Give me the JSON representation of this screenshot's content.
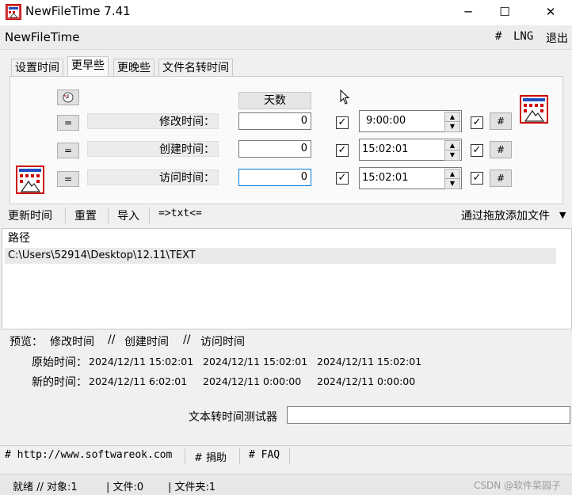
{
  "window": {
    "title": "NewFileTime 7.41",
    "minimize_glyph": "─",
    "maximize_glyph": "☐",
    "close_glyph": "✕"
  },
  "menubar": {
    "app_label": "NewFileTime",
    "items": [
      "#",
      "LNG",
      "退出"
    ]
  },
  "tabs": [
    "设置时间",
    "更早些",
    "更晚些",
    "文件名转时间"
  ],
  "active_tab": "更早些",
  "panel": {
    "days_header": "天数",
    "equals_label": "=",
    "hash_label": "#",
    "check_mark": "✓",
    "rows": [
      {
        "label": "修改时间：",
        "days": "0",
        "time": "9:00:00"
      },
      {
        "label": "创建时间：",
        "days": "0",
        "time": "15:02:01"
      },
      {
        "label": "访问时间：",
        "days": "0",
        "time": "15:02:01"
      }
    ]
  },
  "toolbar": {
    "update_label": "更新时间",
    "reset_label": "重置",
    "import_label": "导入",
    "txt_label": "=>txt<=",
    "drag_label": "通过拖放添加文件",
    "drag_arrow": "▼"
  },
  "list": {
    "header": "路径",
    "rows": [
      "C:\\Users\\52914\\Desktop\\12.11\\TEXT"
    ]
  },
  "preview": {
    "label": "预览：",
    "col_modify": "修改时间",
    "sep": "//",
    "col_create": "创建时间",
    "col_access": "访问时间",
    "original_label": "原始时间：",
    "new_label": "新的时间：",
    "original": [
      "2024/12/11 15:02:01",
      "2024/12/11 15:02:01",
      "2024/12/11 15:02:01"
    ],
    "new": [
      "2024/12/11 6:02:01",
      "2024/12/11 0:00:00",
      "2024/12/11 0:00:00"
    ]
  },
  "tester": {
    "label": "文本转时间测试器",
    "value": ""
  },
  "links": {
    "website": "# http://www.softwareok.com",
    "donate": "# 捐助",
    "faq": "# FAQ"
  },
  "status": {
    "ready": "就绪 // 对象:1",
    "files": "| 文件:0",
    "folders": "| 文件夹:1"
  },
  "watermark": "CSDN @软件菜园子",
  "colors": {
    "accent": "#0078d7",
    "icon_red": "#cc0000",
    "icon_blue": "#1f4fbf"
  }
}
